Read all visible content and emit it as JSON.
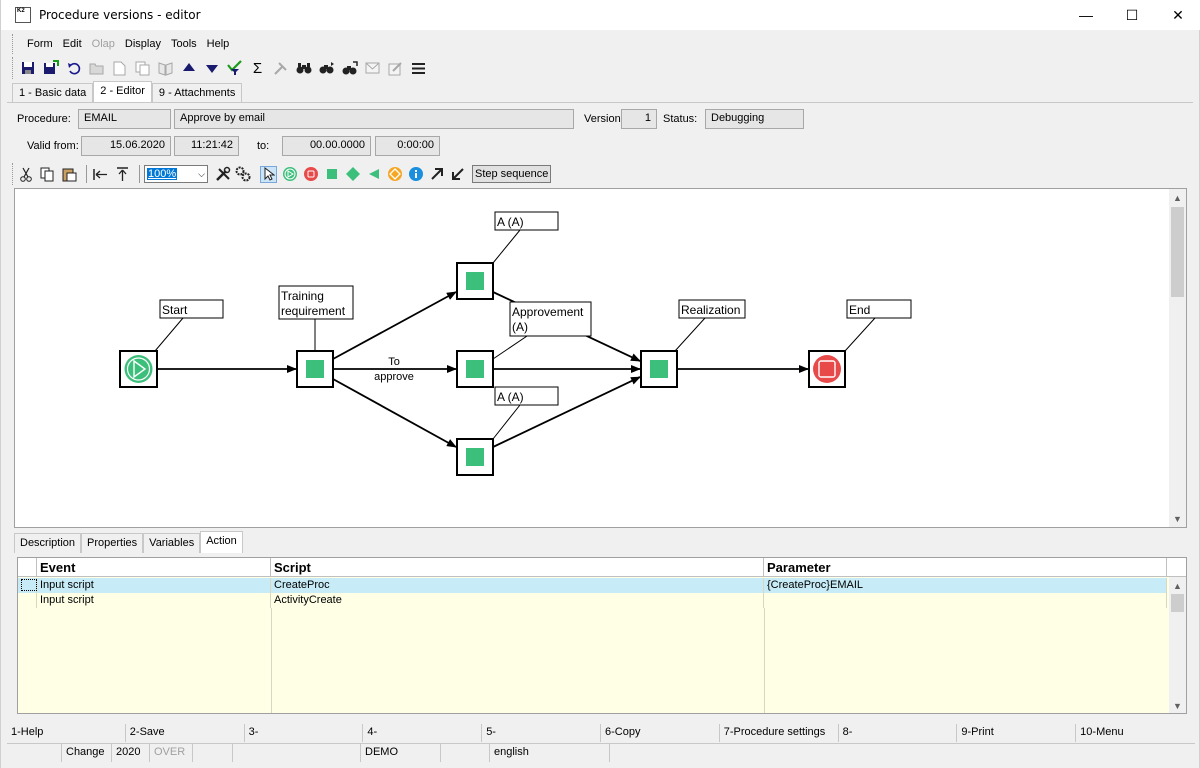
{
  "window": {
    "title": "Procedure versions - editor",
    "app_icon_text": "K2",
    "minimize": "—",
    "maximize": "☐",
    "close": "✕"
  },
  "menu": [
    {
      "label": "Form",
      "enabled": true
    },
    {
      "label": "Edit",
      "enabled": true
    },
    {
      "label": "Olap",
      "enabled": false
    },
    {
      "label": "Display",
      "enabled": true
    },
    {
      "label": "Tools",
      "enabled": true
    },
    {
      "label": "Help",
      "enabled": true
    }
  ],
  "tabs": [
    {
      "label": "1 - Basic data"
    },
    {
      "label": "2 - Editor"
    },
    {
      "label": "9 - Attachments"
    }
  ],
  "form": {
    "procedure_label": "Procedure:",
    "procedure_code": "EMAIL",
    "procedure_name": "Approve by email",
    "version_label": "Version:",
    "version": "1",
    "status_label": "Status:",
    "status": "Debugging",
    "valid_from_label": "Valid from:",
    "valid_from_date": "15.06.2020",
    "valid_from_time": "11:21:42",
    "to_label": "to:",
    "to_date": "00.00.0000",
    "to_time": "0:00:00"
  },
  "editor_toolbar": {
    "zoom": "100%",
    "step_sequence": "Step sequence"
  },
  "diagram": {
    "start_label": "Start",
    "training_label_1": "Training",
    "training_label_2": "requirement",
    "a_top_label": "A (A)",
    "a_bottom_label": "A (A)",
    "approvement_label_1": "Approvement",
    "approvement_label_2": "(A)",
    "realization_label": "Realization",
    "end_label": "End",
    "edge_label_1": "To",
    "edge_label_2": "approve",
    "colors": {
      "activity": "#3dbf7c",
      "start": "#3dbf7c",
      "end": "#e84a4a"
    }
  },
  "lower_tabs": [
    {
      "label": "Description"
    },
    {
      "label": "Properties"
    },
    {
      "label": "Variables"
    },
    {
      "label": "Action"
    }
  ],
  "grid": {
    "headers": {
      "event": "Event",
      "script": "Script",
      "parameter": "Parameter"
    },
    "rows": [
      {
        "event": "Input script",
        "script": "CreateProc",
        "parameter": "{CreateProc}EMAIL"
      },
      {
        "event": "Input script",
        "script": "ActivityCreate",
        "parameter": ""
      }
    ]
  },
  "fkeys": [
    "1-Help",
    "2-Save",
    "3-",
    "4-",
    "5-",
    "6-Copy",
    "7-Procedure settings",
    "8-",
    "9-Print",
    "10-Menu"
  ],
  "statusbar": {
    "mode": "Change",
    "year": "2020",
    "over": "OVER",
    "db": "DEMO",
    "language": "english"
  }
}
